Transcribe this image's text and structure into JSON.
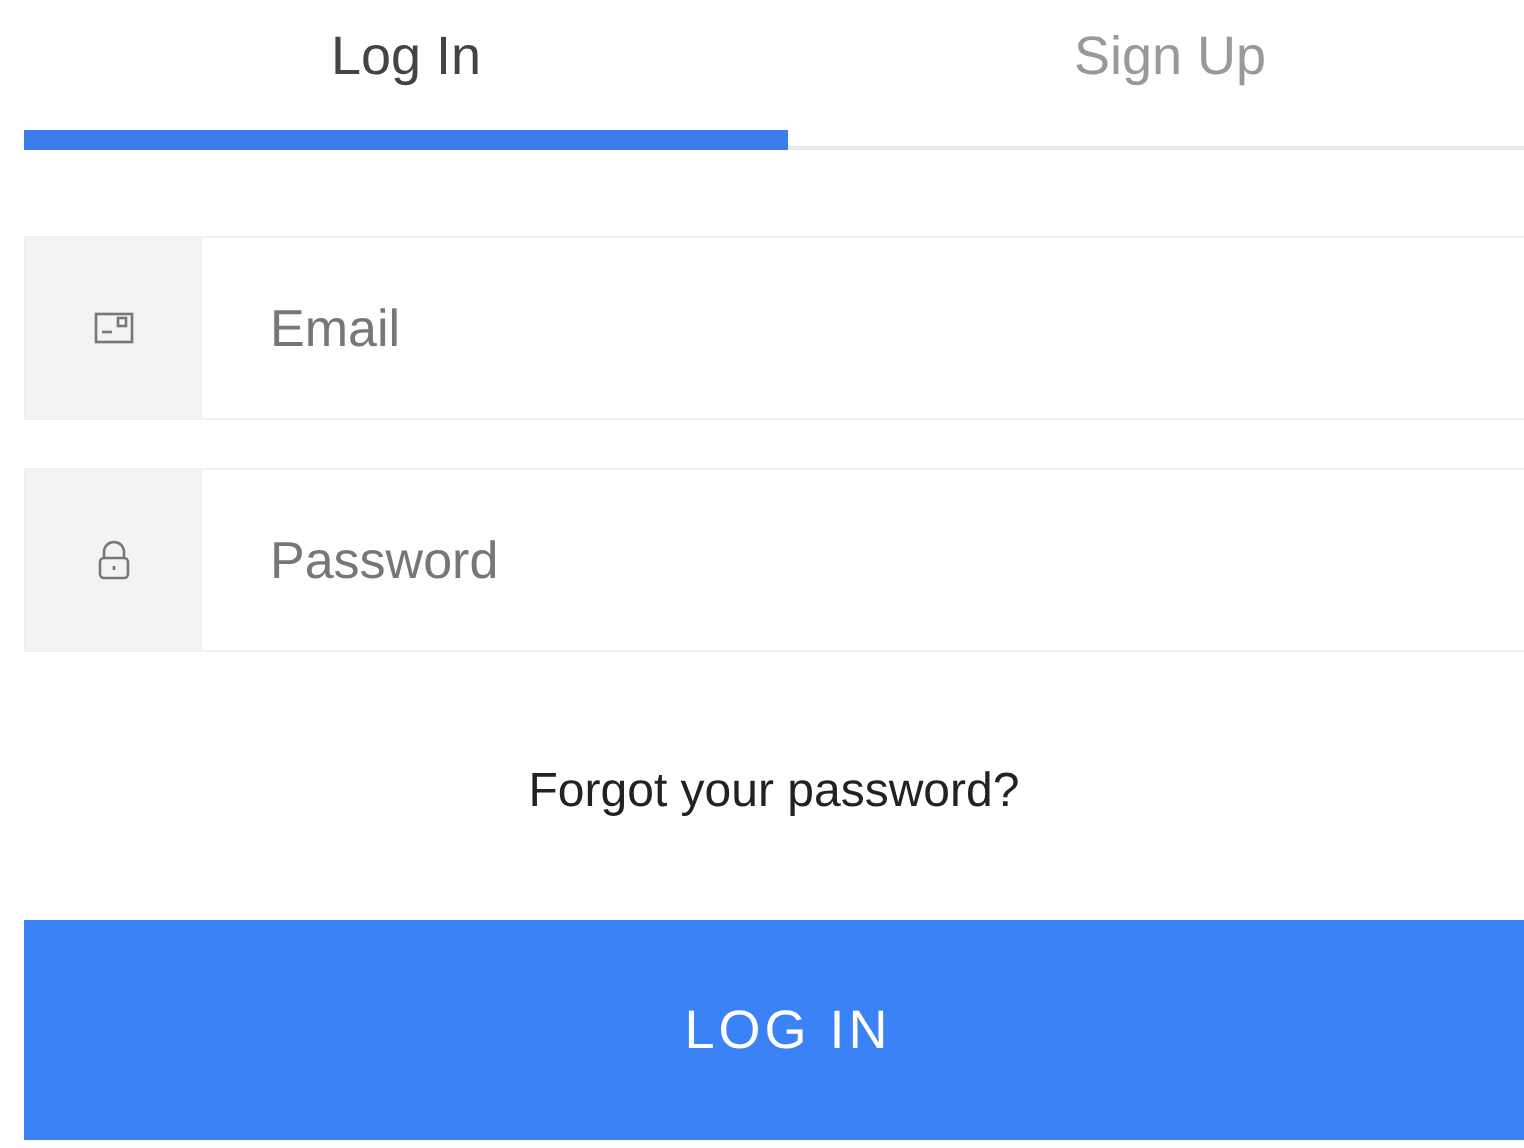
{
  "tabs": [
    {
      "label": "Log In",
      "selected": true
    },
    {
      "label": "Sign Up",
      "selected": false
    }
  ],
  "fields": [
    {
      "kind": "email",
      "placeholder": "Email"
    },
    {
      "kind": "password",
      "placeholder": "Password"
    }
  ],
  "forgot_link": "Forgot your password?",
  "submit_button": "LOG IN"
}
